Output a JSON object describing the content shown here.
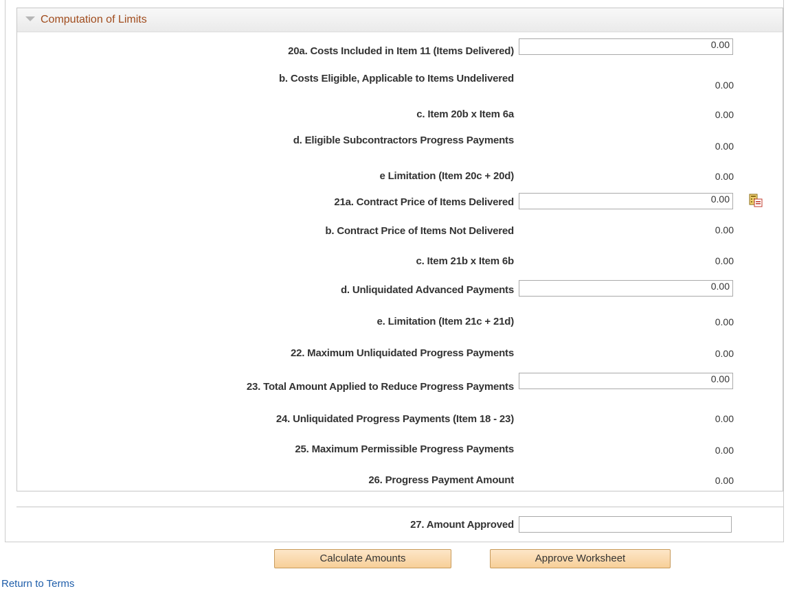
{
  "section": {
    "title": "Computation of Limits"
  },
  "rows": [
    {
      "label": "20a. Costs Included in Item 11 (Items Delivered)",
      "value": "0.00"
    },
    {
      "label": "b. Costs Eligible, Applicable to Items Undelivered",
      "value": "0.00"
    },
    {
      "label": "c. Item 20b x Item 6a",
      "value": "0.00"
    },
    {
      "label": "d. Eligible Subcontractors Progress Payments",
      "value": "0.00"
    },
    {
      "label": "e Limitation (Item 20c + 20d)",
      "value": "0.00"
    },
    {
      "label": "21a. Contract Price of Items Delivered",
      "value": "0.00"
    },
    {
      "label": "b. Contract Price of Items Not Delivered",
      "value": "0.00"
    },
    {
      "label": "c. Item 21b x Item 6b",
      "value": "0.00"
    },
    {
      "label": "d. Unliquidated Advanced Payments",
      "value": "0.00"
    },
    {
      "label": "e. Limitation (Item 21c + 21d)",
      "value": "0.00"
    },
    {
      "label": "22. Maximum Unliquidated Progress Payments",
      "value": "0.00"
    },
    {
      "label": "23. Total Amount Applied to Reduce Progress Payments",
      "value": "0.00"
    },
    {
      "label": "24. Unliquidated Progress Payments (Item 18 - 23)",
      "value": "0.00"
    },
    {
      "label": "25. Maximum Permissible Progress Payments",
      "value": "0.00"
    },
    {
      "label": "26. Progress Payment Amount",
      "value": "0.00"
    }
  ],
  "approved": {
    "label": "27. Amount Approved",
    "value": ""
  },
  "buttons": {
    "calculate": "Calculate Amounts",
    "approve": "Approve Worksheet"
  },
  "links": {
    "return": "Return to Terms"
  },
  "icons": {
    "lookup": "calculator-icon"
  }
}
